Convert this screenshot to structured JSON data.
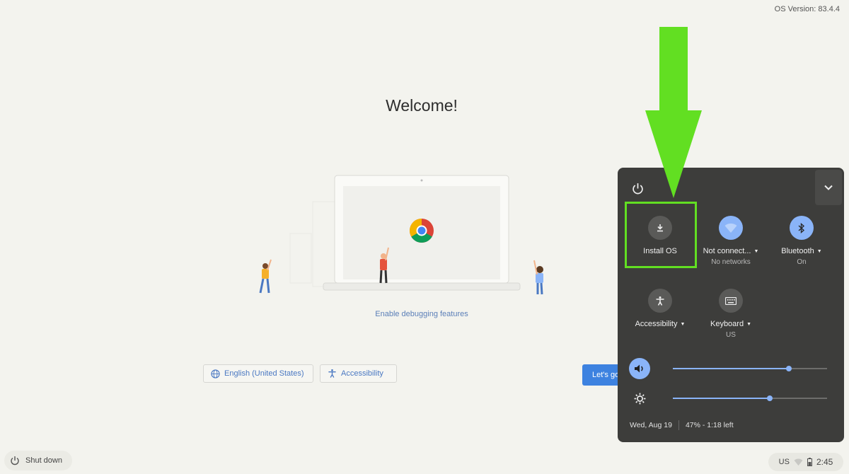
{
  "os_version": "OS Version: 83.4.4",
  "welcome": {
    "title": "Welcome!",
    "debug_link": "Enable debugging features",
    "language_button": "English (United States)",
    "accessibility_button": "Accessibility",
    "lets_go_button": "Let's go"
  },
  "shelf": {
    "shutdown_label": "Shut down",
    "input_method": "US",
    "clock": "2:45"
  },
  "quick_settings": {
    "tiles": [
      {
        "label": "Install OS",
        "sub": "",
        "icon": "download-icon",
        "active": false
      },
      {
        "label": "Not connect...",
        "sub": "No networks",
        "icon": "wifi-icon",
        "active": true
      },
      {
        "label": "Bluetooth",
        "sub": "On",
        "icon": "bluetooth-icon",
        "active": true
      },
      {
        "label": "Accessibility",
        "sub": "",
        "icon": "accessibility-icon",
        "active": false
      },
      {
        "label": "Keyboard",
        "sub": "US",
        "icon": "keyboard-icon",
        "active": false
      }
    ],
    "volume_level": 0.75,
    "brightness_level": 0.63,
    "date": "Wed, Aug 19",
    "battery": "47% - 1:18 left"
  },
  "colors": {
    "accent": "#3d82e0",
    "panel_bg": "#3d3d3b",
    "active_toggle": "#8ab4f8",
    "annotation_green": "#62df22"
  }
}
